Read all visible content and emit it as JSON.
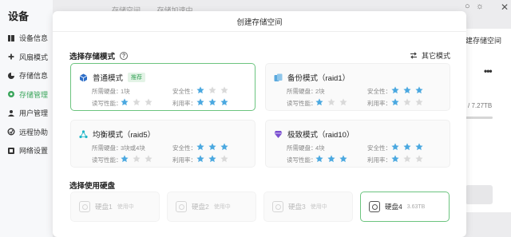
{
  "app": {
    "title": "设备"
  },
  "sidebar": {
    "items": [
      {
        "label": "设备信息",
        "icon": "device-info-icon"
      },
      {
        "label": "风扇模式",
        "icon": "fan-icon"
      },
      {
        "label": "存储信息",
        "icon": "storage-pie-icon"
      },
      {
        "label": "存储管理",
        "icon": "storage-manage-icon",
        "active": true
      },
      {
        "label": "用户管理",
        "icon": "user-icon"
      },
      {
        "label": "远程协助",
        "icon": "remote-icon"
      },
      {
        "label": "网络设置",
        "icon": "network-icon"
      }
    ]
  },
  "background": {
    "tabs": [
      "存储空间",
      "存储加速中"
    ],
    "storage_label": "建存储空间",
    "size_text": "/ 7.27TB",
    "more": "•••"
  },
  "dialog": {
    "title": "创建存储空间",
    "mode_section_title": "选择存储模式",
    "other_mode_label": "其它模式",
    "disk_section_title": "选择使用硬盘",
    "modes": [
      {
        "name": "普通模式",
        "badge": "推荐",
        "icon": "cube-icon",
        "req_label": "所需硬盘：",
        "req_value": "1块",
        "safety_label": "安全性：",
        "safety": 1,
        "perf_label": "读写性能：",
        "perf": 1,
        "util_label": "利用率：",
        "util": 3
      },
      {
        "name": "备份模式（raid1）",
        "icon": "backup-icon",
        "req_label": "所需硬盘：",
        "req_value": "2块",
        "safety_label": "安全性：",
        "safety": 3,
        "perf_label": "读写性能：",
        "perf": 1,
        "util_label": "利用率：",
        "util": 1
      },
      {
        "name": "均衡模式（raid5）",
        "icon": "balance-icon",
        "req_label": "所需硬盘：",
        "req_value": "3块或4块",
        "safety_label": "安全性：",
        "safety": 3,
        "perf_label": "读写性能：",
        "perf": 1,
        "util_label": "利用率：",
        "util": 2
      },
      {
        "name": "极致模式（raid10）",
        "icon": "extreme-icon",
        "req_label": "所需硬盘：",
        "req_value": "4块",
        "safety_label": "安全性：",
        "safety": 3,
        "perf_label": "读写性能：",
        "perf": 3,
        "util_label": "利用率：",
        "util": 1
      }
    ],
    "disks": [
      {
        "name": "硬盘1",
        "status": "使用中"
      },
      {
        "name": "硬盘2",
        "status": "使用中"
      },
      {
        "name": "硬盘3",
        "status": "使用中"
      },
      {
        "name": "硬盘4",
        "status": "3.63TB",
        "selected": true
      }
    ]
  },
  "colors": {
    "accent": "#3aa55b",
    "star_on": "#4aa8e0",
    "star_off": "#d9d9d9",
    "selected_border": "#6cc47f"
  }
}
